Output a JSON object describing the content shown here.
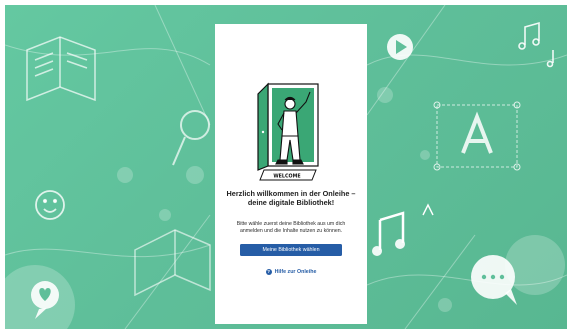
{
  "welcome": {
    "title": "Herzlich willkommen in der Onleihe – deine digitale Bibliothek!",
    "text": "Bitte wähle zuerst deine Bibliothek aus um dich anmelden und die Inhalte nutzen zu können.",
    "choose_library_label": "Meine Bibliothek wählen",
    "help_label": "Hilfe zur Onleihe",
    "illustration_sign": "WELCOME"
  },
  "colors": {
    "background": "#5fbf9a",
    "door": "#3aa775",
    "primary": "#265da6"
  },
  "icons": {
    "help": "question-circle-icon",
    "background": [
      "book-icon",
      "magnifier-icon",
      "smiley-icon",
      "heart-chat-icon",
      "music-note-icon",
      "play-icon",
      "letter-a-icon",
      "chat-bubble-icon"
    ]
  }
}
